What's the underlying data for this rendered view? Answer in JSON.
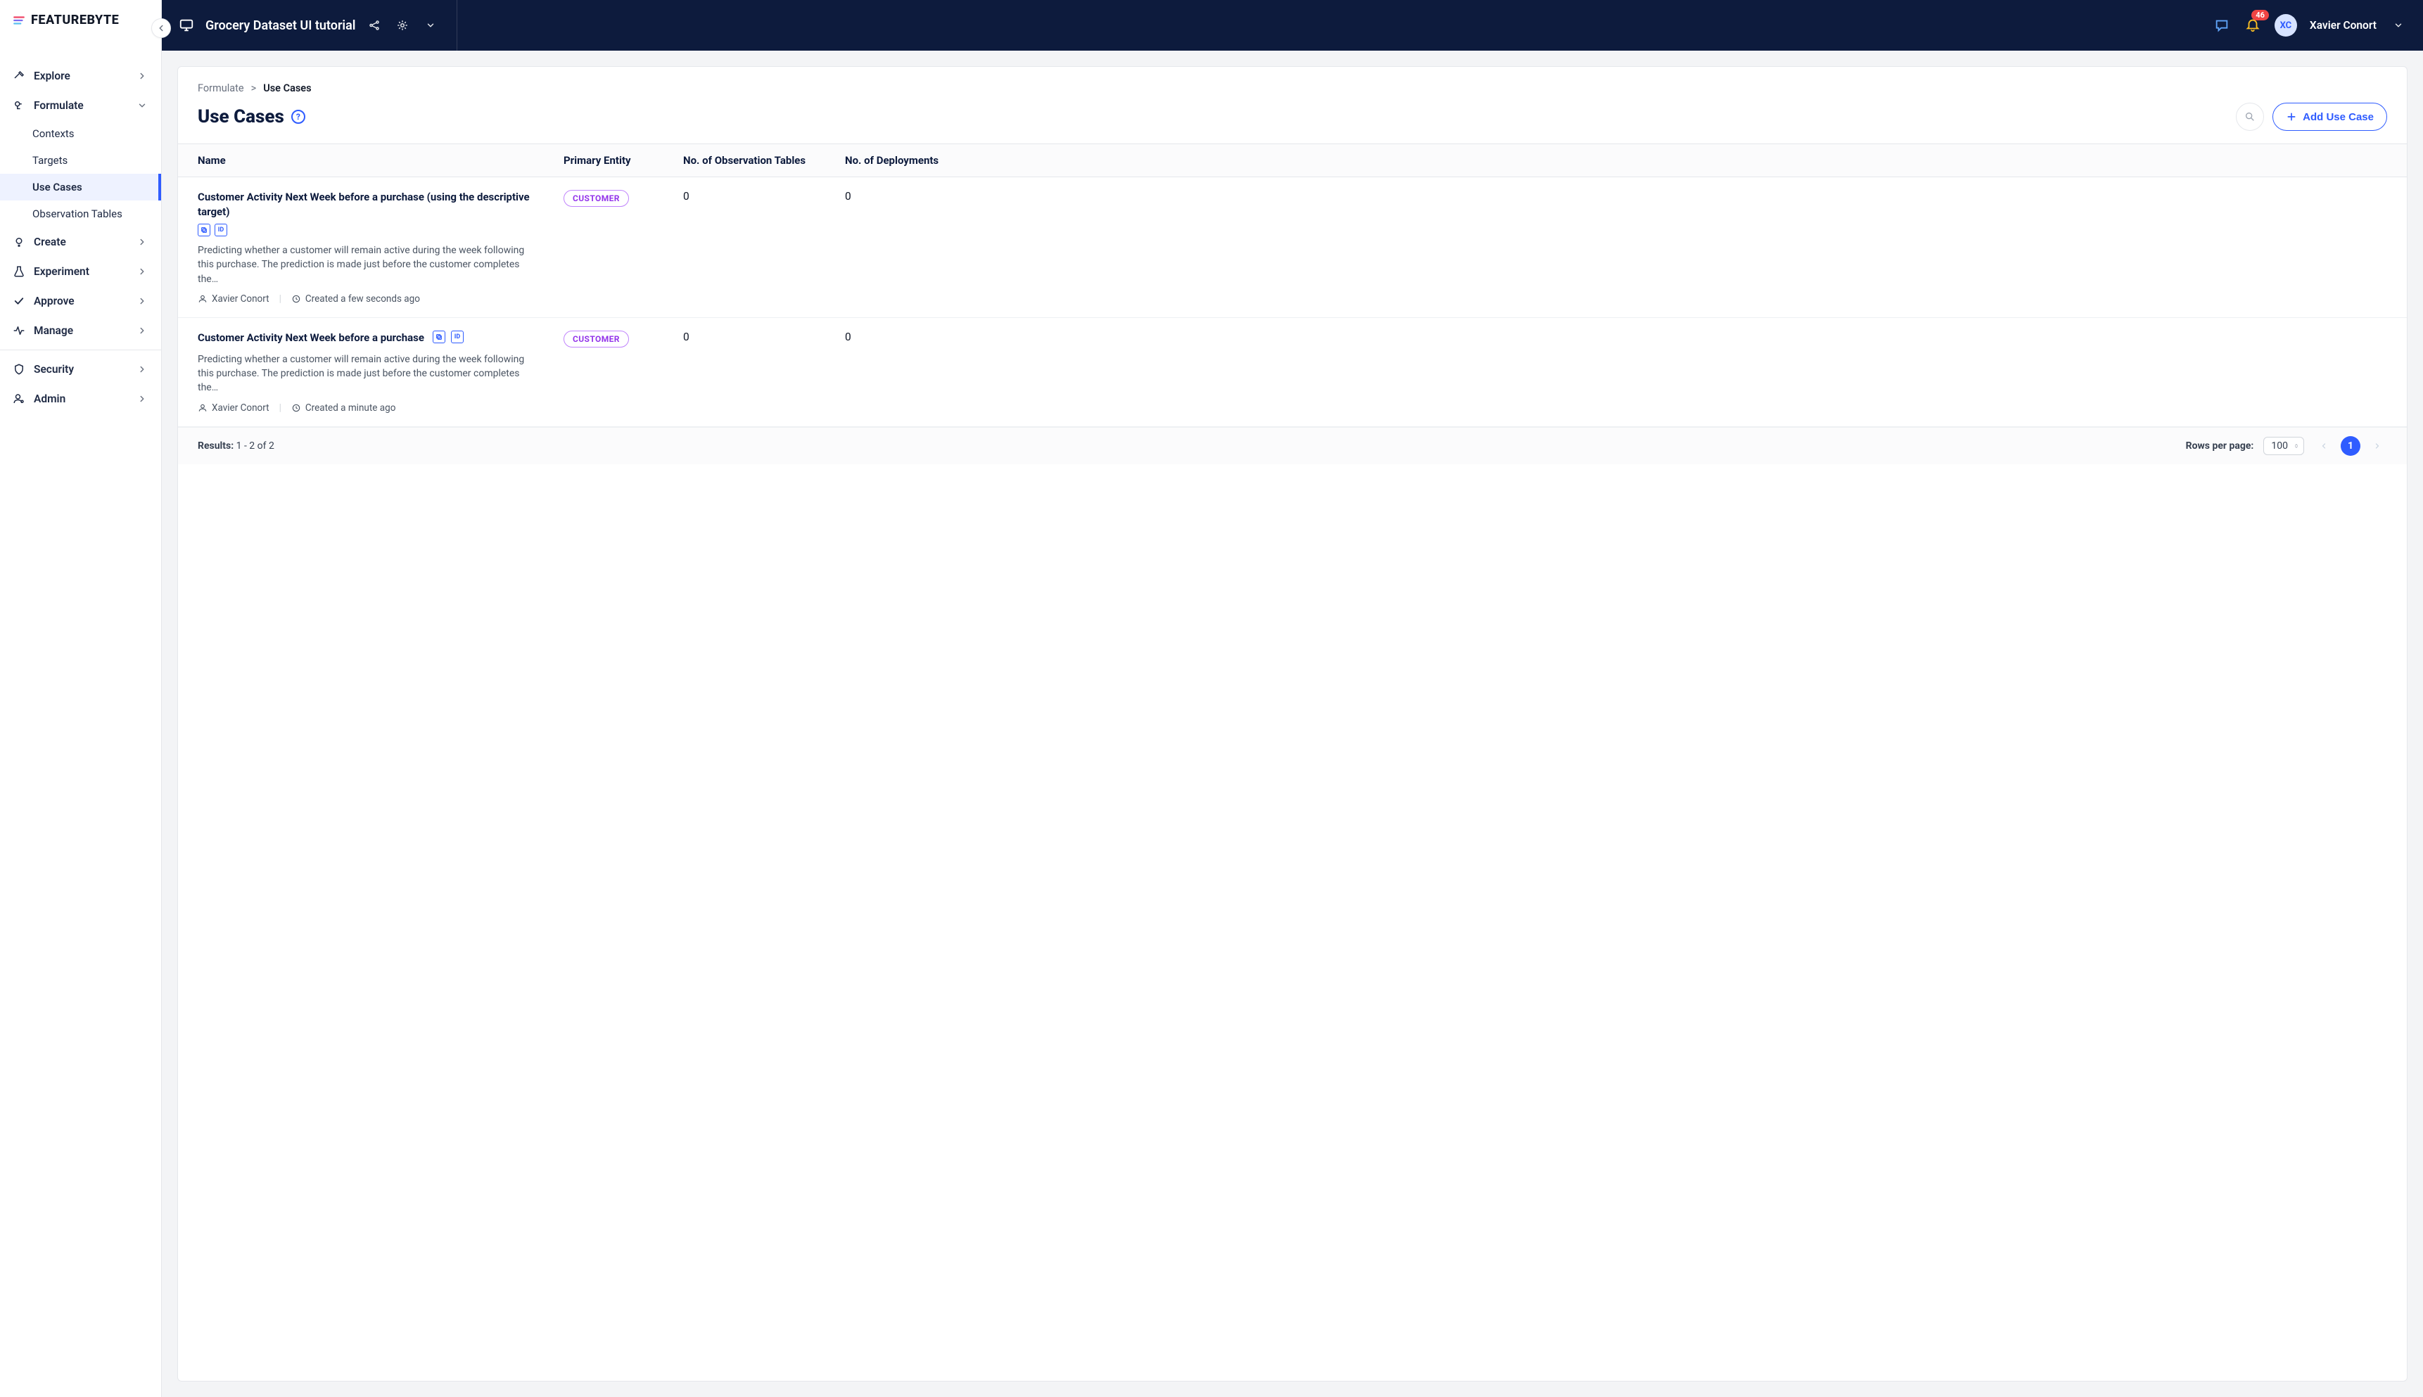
{
  "brand": {
    "name": "FEATUREBYTE"
  },
  "context": {
    "title": "Grocery Dataset UI tutorial"
  },
  "notifications": {
    "count": "46"
  },
  "user": {
    "initials": "XC",
    "name": "Xavier Conort"
  },
  "sidebar": {
    "items": [
      {
        "label": "Explore"
      },
      {
        "label": "Formulate",
        "expanded": true,
        "children": [
          {
            "label": "Contexts"
          },
          {
            "label": "Targets"
          },
          {
            "label": "Use Cases",
            "active": true
          },
          {
            "label": "Observation Tables"
          }
        ]
      },
      {
        "label": "Create"
      },
      {
        "label": "Experiment"
      },
      {
        "label": "Approve"
      },
      {
        "label": "Manage"
      },
      {
        "label": "Security"
      },
      {
        "label": "Admin"
      }
    ]
  },
  "breadcrumbs": {
    "root": "Formulate",
    "sep": ">",
    "current": "Use Cases"
  },
  "page": {
    "title": "Use Cases",
    "add_label": "Add Use Case"
  },
  "table": {
    "columns": {
      "name": "Name",
      "primary_entity": "Primary Entity",
      "obs_tables": "No. of Observation Tables",
      "deployments": "No. of Deployments"
    },
    "rows": [
      {
        "title": "Customer Activity Next Week before a purchase (using the descriptive target)",
        "entity": "CUSTOMER",
        "obs_tables": "0",
        "deployments": "0",
        "desc": "Predicting whether a customer will remain active during the week following this purchase. The prediction is made just before the customer completes the…",
        "author": "Xavier Conort",
        "created": "Created a few seconds ago"
      },
      {
        "title": "Customer Activity Next Week before a purchase",
        "entity": "CUSTOMER",
        "obs_tables": "0",
        "deployments": "0",
        "desc": "Predicting whether a customer will remain active during the week following this purchase. The prediction is made just before the customer completes the…",
        "author": "Xavier Conort",
        "created": "Created a minute ago"
      }
    ]
  },
  "footer": {
    "results_label": "Results:",
    "results_range": "1 - 2 of 2",
    "rpp_label": "Rows per page:",
    "rpp_value": "100",
    "page_current": "1"
  }
}
